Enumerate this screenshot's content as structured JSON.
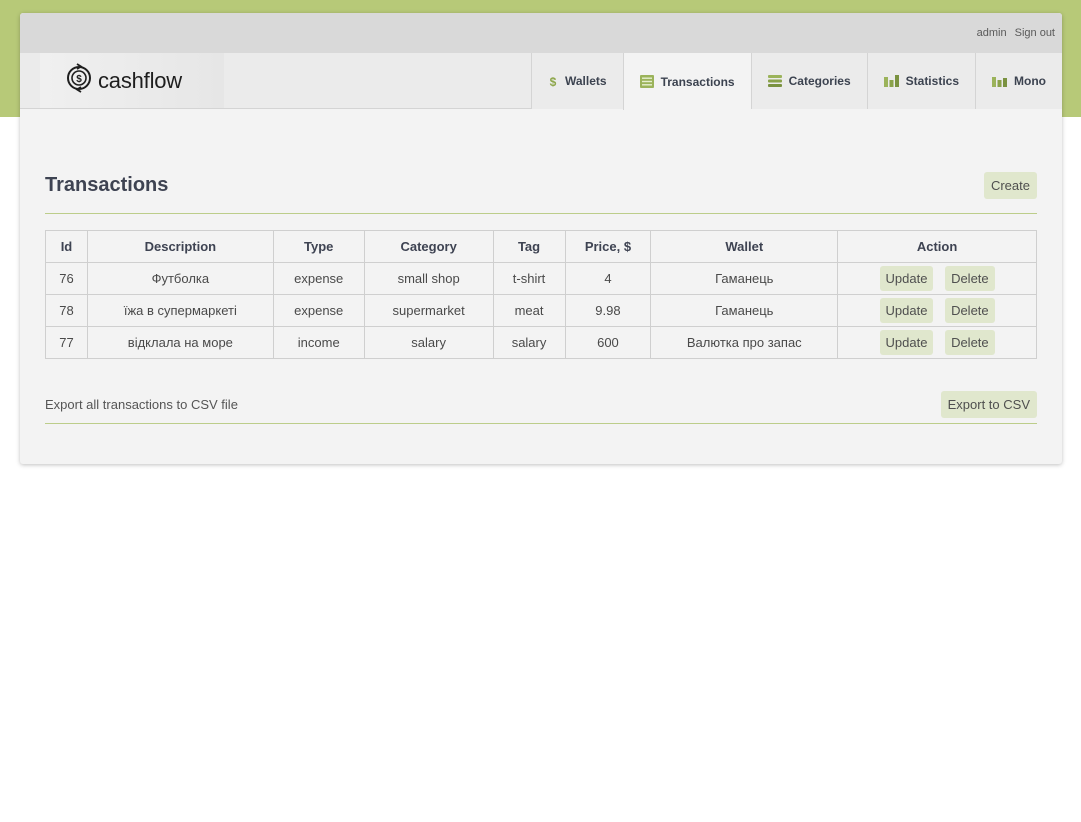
{
  "topbar": {
    "user": "admin",
    "signout": "Sign out"
  },
  "logo": {
    "text": "cashflow"
  },
  "nav": [
    {
      "label": "Wallets",
      "icon": "dollar-icon"
    },
    {
      "label": "Transactions",
      "icon": "list-icon",
      "active": true
    },
    {
      "label": "Categories",
      "icon": "stack-icon"
    },
    {
      "label": "Statistics",
      "icon": "bar-chart-icon"
    },
    {
      "label": "Mono",
      "icon": "bar-chart-icon"
    }
  ],
  "page": {
    "title": "Transactions",
    "create_label": "Create"
  },
  "table": {
    "headers": [
      "Id",
      "Description",
      "Type",
      "Category",
      "Tag",
      "Price, $",
      "Wallet",
      "Action"
    ],
    "rows": [
      {
        "id": "76",
        "description": "Футболка",
        "type": "expense",
        "category": "small shop",
        "tag": "t-shirt",
        "price": "4",
        "wallet": "Гаманець"
      },
      {
        "id": "78",
        "description": "їжа в супермаркеті",
        "type": "expense",
        "category": "supermarket",
        "tag": "meat",
        "price": "9.98",
        "wallet": "Гаманець"
      },
      {
        "id": "77",
        "description": "відклала на море",
        "type": "income",
        "category": "salary",
        "tag": "salary",
        "price": "600",
        "wallet": "Валютка про запас"
      }
    ],
    "update_label": "Update",
    "delete_label": "Delete"
  },
  "export": {
    "text": "Export all transactions to CSV file",
    "button": "Export to CSV"
  },
  "colors": {
    "accent": "#b7c978",
    "button_bg": "#e0e7cd",
    "rule": "#bccd8a"
  }
}
